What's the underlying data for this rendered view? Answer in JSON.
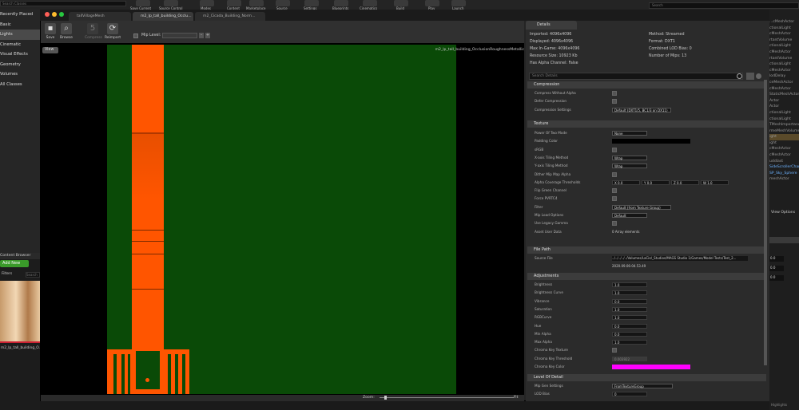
{
  "top": {
    "search_placeholder": "Search Classes",
    "right_search_placeholder": "Search",
    "toolbar": [
      "Save Current",
      "Source Control",
      "Modes",
      "Content",
      "Marketplace",
      "Source",
      "Settings",
      "Blueprints",
      "Cinematics",
      "Build",
      "Play",
      "Launch"
    ]
  },
  "left_panel": {
    "items": [
      "Recently Placed",
      "Basic",
      "Lights",
      "Cinematic",
      "Visual Effects",
      "Geometry",
      "Volumes",
      "All Classes"
    ],
    "content_browser_label": "Content Browser",
    "add_new": "Add New",
    "filters": "Filters",
    "search_placeholder": "Search",
    "asset_name": "m2_lp_tall_building_O..."
  },
  "right_panel": {
    "items": [
      "...cMeshActor",
      "ctionalLight",
      "cMeshActor",
      "rtantVolume",
      "ctionalLight",
      "cMeshActor",
      "rtantVolume",
      "ctionalLight",
      "cMeshActor",
      "lodDelay",
      "ceMeshActor",
      "cMeshActor",
      "StaticMeshActor",
      "Actor",
      "Actor",
      "ctionalLight",
      "ctionalLight",
      "TMeshImportance",
      "rmeMeshVolume",
      "ight",
      "ight",
      "cMeshActor",
      "cMeshActor",
      "uddlast",
      "SideScrollerCharacter",
      "SP_Sky_Sphere",
      "meshActor"
    ],
    "view_options": "View Options",
    "values": [
      "0.0",
      "0.0",
      "0.0"
    ],
    "highlights": "Highlights"
  },
  "window": {
    "tabs": [
      "tallVillageMesh",
      "m2_lp_tall_building_Occlu...",
      "m2_Cicada_Building_Norm..."
    ],
    "toolbar": {
      "save": "Save",
      "browse": "Browse",
      "compress": "Compress",
      "reimport": "Reimport",
      "mip_level_label": "Mip Level:"
    },
    "viewport": {
      "view_button": "View",
      "texture_name": "m2_lp_tall_building_OcclusionRoughnessMetallic",
      "zoom_label": "Zoom:",
      "zoom_value": "Fit"
    }
  },
  "details": {
    "tab_label": "Details",
    "info_left": [
      "Imported: 4096x4096",
      "Displayed: 4096x4096",
      "Max In-Game: 4096x4096",
      "Resource Size: 10923 Kb",
      "Has Alpha Channel: False"
    ],
    "info_right": [
      "Method: Streamed",
      "Format: DXT1",
      "Combined LOD Bias: 0",
      "Number of Mips: 13"
    ],
    "search_placeholder": "Search Details",
    "sections": {
      "compression": {
        "title": "Compression",
        "rows": [
          {
            "label": "Compress Without Alpha",
            "type": "check"
          },
          {
            "label": "Defer Compression",
            "type": "check"
          },
          {
            "label": "Compression Settings",
            "type": "dropdown",
            "value": "Default (DXT1/5, BC1/3 on DX11)"
          }
        ]
      },
      "texture": {
        "title": "Texture",
        "rows": [
          {
            "label": "Power Of Two Mode",
            "type": "dropdown",
            "value": "None"
          },
          {
            "label": "Padding Color",
            "type": "color"
          },
          {
            "label": "sRGB",
            "type": "check"
          },
          {
            "label": "X-axis Tiling Method",
            "type": "dropdown",
            "value": "Wrap"
          },
          {
            "label": "Y-axis Tiling Method",
            "type": "dropdown",
            "value": "Wrap"
          },
          {
            "label": "Dither Mip Map Alpha",
            "type": "check"
          },
          {
            "label": "Alpha Coverage Thresholds",
            "type": "vec4",
            "x": "0.0",
            "y": "0.0",
            "z": "0.0",
            "w": "1.0"
          },
          {
            "label": "Flip Green Channel",
            "type": "check"
          },
          {
            "label": "Force PVRTC4",
            "type": "check"
          },
          {
            "label": "Filter",
            "type": "dropdown",
            "value": "Default (from Texture Group)"
          },
          {
            "label": "Mip Load Options",
            "type": "dropdown",
            "value": "Default"
          },
          {
            "label": "Use Legacy Gamma",
            "type": "check"
          },
          {
            "label": "Asset User Data",
            "type": "text",
            "value": "0 Array elements"
          }
        ]
      },
      "file_path": {
        "title": "File Path",
        "rows": [
          {
            "label": "Source File",
            "type": "text",
            "value": "../../../../../Volumes/LaCie/_Studios/MAGS Studio 1/Games/Model Tests/Test_2..."
          },
          {
            "label": "",
            "type": "text",
            "value": "2020.09.06-04.53.49"
          }
        ]
      },
      "adjustments": {
        "title": "Adjustments",
        "rows": [
          {
            "label": "Brightness",
            "type": "num",
            "value": "1.0"
          },
          {
            "label": "Brightness Curve",
            "type": "num",
            "value": "1.0"
          },
          {
            "label": "Vibrance",
            "type": "num",
            "value": "0.0"
          },
          {
            "label": "Saturation",
            "type": "num",
            "value": "1.0"
          },
          {
            "label": "RGBCurve",
            "type": "num",
            "value": "1.0"
          },
          {
            "label": "Hue",
            "type": "num",
            "value": "0.0"
          },
          {
            "label": "Min Alpha",
            "type": "num",
            "value": "0.0"
          },
          {
            "label": "Max Alpha",
            "type": "num",
            "value": "1.0"
          },
          {
            "label": "Chroma Key Texture",
            "type": "check"
          },
          {
            "label": "Chroma Key Threshold",
            "type": "num",
            "value": "0.003922"
          },
          {
            "label": "Chroma Key Color",
            "type": "color2"
          }
        ]
      },
      "lod": {
        "title": "Level Of Detail",
        "rows": [
          {
            "label": "Mip Gen Settings",
            "type": "dropdown",
            "value": "FromTextureGroup"
          },
          {
            "label": "LOD Bias",
            "type": "num",
            "value": "0"
          }
        ]
      }
    }
  },
  "colors": {
    "texture_green": "#0a4a07",
    "texture_orange": "#ff5500",
    "chroma_magenta": "#ff00ff",
    "add_new_green": "#3a9a2a"
  }
}
